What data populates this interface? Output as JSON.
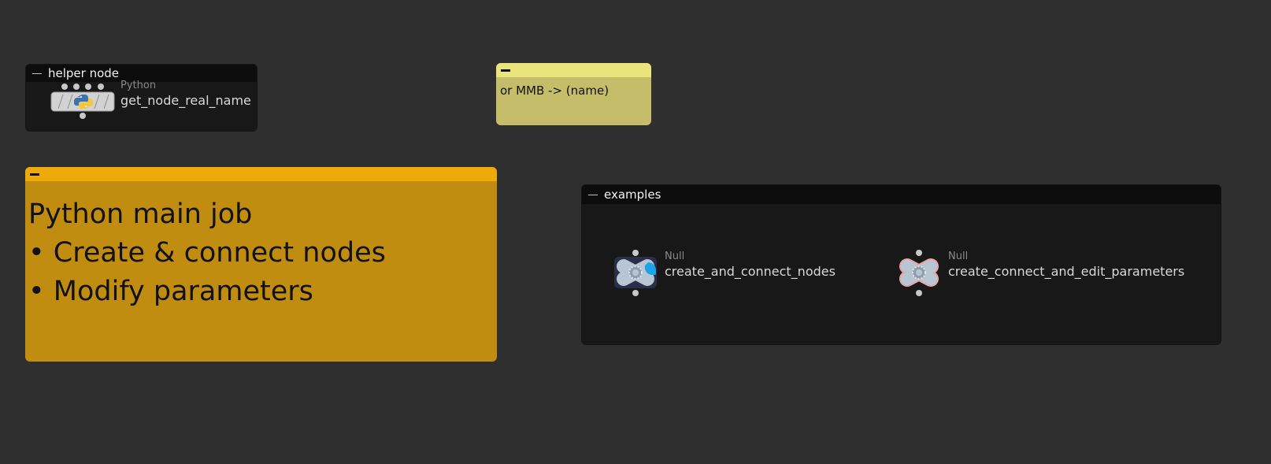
{
  "network_boxes": {
    "helper": {
      "title": "helper node"
    },
    "examples": {
      "title": "examples"
    }
  },
  "sticky_notes": {
    "yellow": {
      "text": "or MMB -> (name)",
      "header_color": "#ebe47c",
      "body_color": "#c6bd6a"
    },
    "orange": {
      "lines": [
        "Python main job",
        "• Create & connect nodes",
        "• Modify parameters"
      ],
      "header_color": "#eeaa08",
      "body_color": "#c18d10"
    }
  },
  "nodes": {
    "python_node": {
      "type": "Python",
      "name": "get_node_real_name",
      "icon": "python-icon"
    },
    "null_node_1": {
      "type": "Null",
      "name": "create_and_connect_nodes",
      "icon": "null-icon",
      "flag_color": "#1aa3e8"
    },
    "null_node_2": {
      "type": "Null",
      "name": "create_connect_and_edit_parameters",
      "icon": "null-icon",
      "outline_color": "#e8a5a5"
    }
  }
}
